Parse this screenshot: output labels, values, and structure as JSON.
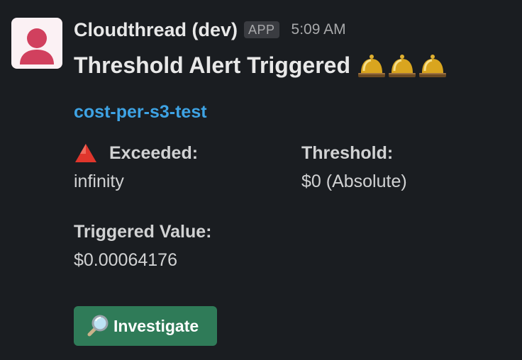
{
  "message": {
    "sender": "Cloudthread (dev)",
    "app_badge": "APP",
    "time": "5:09 AM",
    "title": "Threshold Alert Triggered",
    "title_emoji": [
      "bell-icon",
      "bell-icon",
      "bell-icon"
    ],
    "link": "cost-per-s3-test"
  },
  "fields": {
    "exceeded": {
      "icon": "red-triangle-up-icon",
      "label": "Exceeded:",
      "value": "infinity"
    },
    "threshold": {
      "label": "Threshold:",
      "value": "$0 (Absolute)"
    },
    "triggered": {
      "label": "Triggered Value:",
      "value": "$0.00064176"
    }
  },
  "button": {
    "icon": "magnifying-glass-icon",
    "label": "Investigate"
  },
  "colors": {
    "background": "#1a1d21",
    "link": "#3ea3e4",
    "button": "#2f7b58",
    "avatar": "#d1405e",
    "badge_bg": "#3a3c41"
  }
}
